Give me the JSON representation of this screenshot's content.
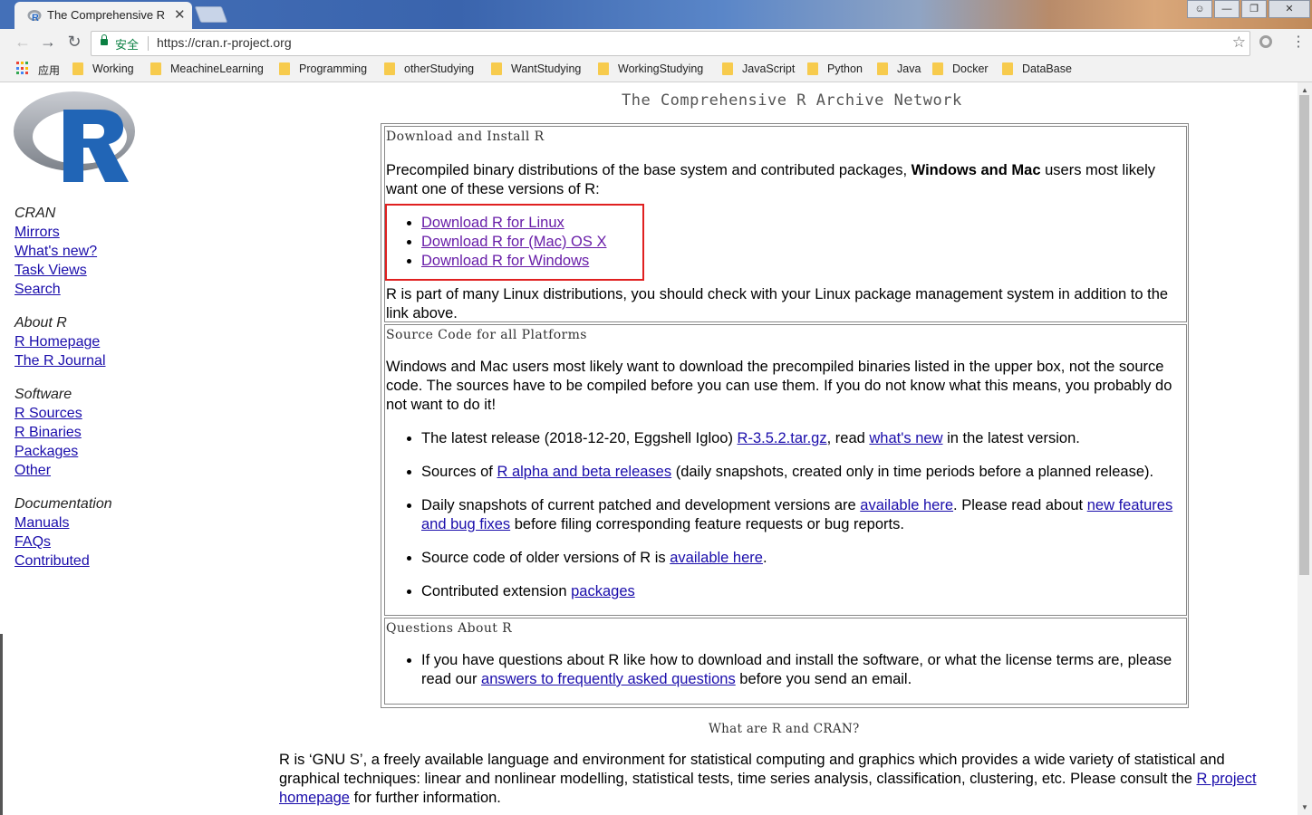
{
  "browser": {
    "tab_title": "The Comprehensive R Archive Network",
    "tab_title_display": "The Comprehensive R",
    "close_glyph": "✕",
    "secure_label": "安全",
    "url": "https://cran.r-project.org",
    "bookmarks_apps_label": "应用",
    "bookmarks": [
      "Working",
      "MeachineLearning",
      "Programming",
      "otherStudying",
      "WantStudying",
      "WorkingStudying",
      "JavaScript",
      "Python",
      "Java",
      "Docker",
      "DataBase"
    ]
  },
  "page": {
    "title": "The Comprehensive R Archive Network",
    "sidebar": {
      "cran": {
        "header": "CRAN",
        "links": [
          "Mirrors",
          "What's new?",
          "Task Views",
          "Search"
        ]
      },
      "about": {
        "header": "About R",
        "links": [
          "R Homepage",
          "The R Journal"
        ]
      },
      "software": {
        "header": "Software",
        "links": [
          "R Sources",
          "R Binaries",
          "Packages",
          "Other"
        ]
      },
      "documentation": {
        "header": "Documentation",
        "links": [
          "Manuals",
          "FAQs",
          "Contributed"
        ]
      }
    },
    "download": {
      "heading": "Download and Install R",
      "intro_1": "Precompiled binary distributions of the base system and contributed packages, ",
      "intro_bold": "Windows and Mac",
      "intro_2": " users most likely want one of these versions of R:",
      "links": [
        "Download R for Linux",
        "Download R for (Mac) OS X",
        "Download R for Windows"
      ],
      "note": "R is part of many Linux distributions, you should check with your Linux package management system in addition to the link above."
    },
    "source": {
      "heading": "Source Code for all Platforms",
      "intro": "Windows and Mac users most likely want to download the precompiled binaries listed in the upper box, not the source code. The sources have to be compiled before you can use them. If you do not know what this means, you probably do not want to do it!",
      "item1_pre": "The latest release (2018-12-20, Eggshell Igloo) ",
      "item1_link1": "R-3.5.2.tar.gz",
      "item1_mid": ", read ",
      "item1_link2": "what's new",
      "item1_post": " in the latest version.",
      "item2_pre": "Sources of ",
      "item2_link": "R alpha and beta releases",
      "item2_post": " (daily snapshots, created only in time periods before a planned release).",
      "item3_pre": "Daily snapshots of current patched and development versions are ",
      "item3_link1": "available here",
      "item3_mid": ". Please read about ",
      "item3_link2": "new features and bug fixes",
      "item3_post": " before filing corresponding feature requests or bug reports.",
      "item4_pre": "Source code of older versions of R is ",
      "item4_link": "available here",
      "item4_post": ".",
      "item5_pre": "Contributed extension ",
      "item5_link": "packages"
    },
    "questions": {
      "heading": "Questions About R",
      "item_pre": "If you have questions about R like how to download and install the software, or what the license terms are, please read our ",
      "item_link": "answers to frequently asked questions",
      "item_post": " before you send an email."
    },
    "what": {
      "heading": "What are R and CRAN?",
      "text": "R is ‘GNU S’, a freely available language and environment for statistical computing and graphics which provides a wide variety of statistical and graphical techniques: linear and nonlinear modelling, statistical tests, time series analysis, classification, clustering, etc. Please consult the ",
      "link": "R project homepage",
      "post": " for further information."
    }
  },
  "colors": {
    "link": "#1a0dab",
    "visited": "#681da8",
    "highlight": "#e02020",
    "secure": "#0b8043"
  }
}
